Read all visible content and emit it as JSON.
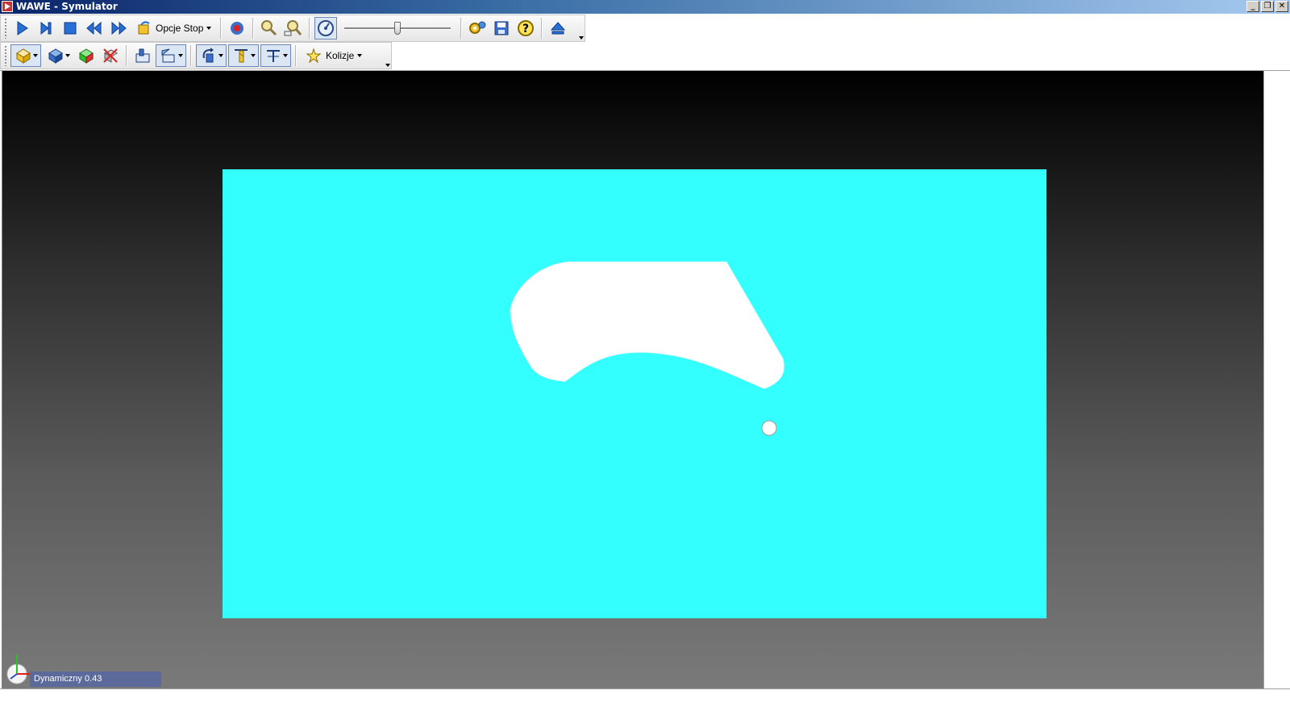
{
  "window": {
    "title": "WAWE - Symulator",
    "controls": [
      "_",
      "❐",
      "✕"
    ]
  },
  "toolbar1": {
    "stop_options_label": "Opcje Stop",
    "speed_level": 0.5,
    "icons": [
      "play-icon",
      "step-icon",
      "stop-icon",
      "rewind-icon",
      "fast-forward-icon",
      "stop-options-icon",
      "record-icon",
      "zoom-icon",
      "zoom-fit-icon",
      "speed-icon",
      "settings-icon",
      "save-icon",
      "help-icon",
      "eject-icon"
    ]
  },
  "toolbar2": {
    "collisions_label": "Kolizje",
    "icons": [
      "stock-view-icon",
      "part-view-icon",
      "compare-icon",
      "delete-icon",
      "machine-view-icon",
      "section-view-icon",
      "rotate-view-icon",
      "tool-view-icon",
      "axis-view-icon",
      "collisions-icon"
    ]
  },
  "viewport": {
    "stock_color": "#33ffff",
    "background_top": "#000000",
    "background_bottom": "#7a7a7a",
    "mode_text": "Dynamiczny 0.43"
  },
  "colors": {
    "accent": "#0a246a",
    "mode_bar": "#5b6a9a"
  }
}
